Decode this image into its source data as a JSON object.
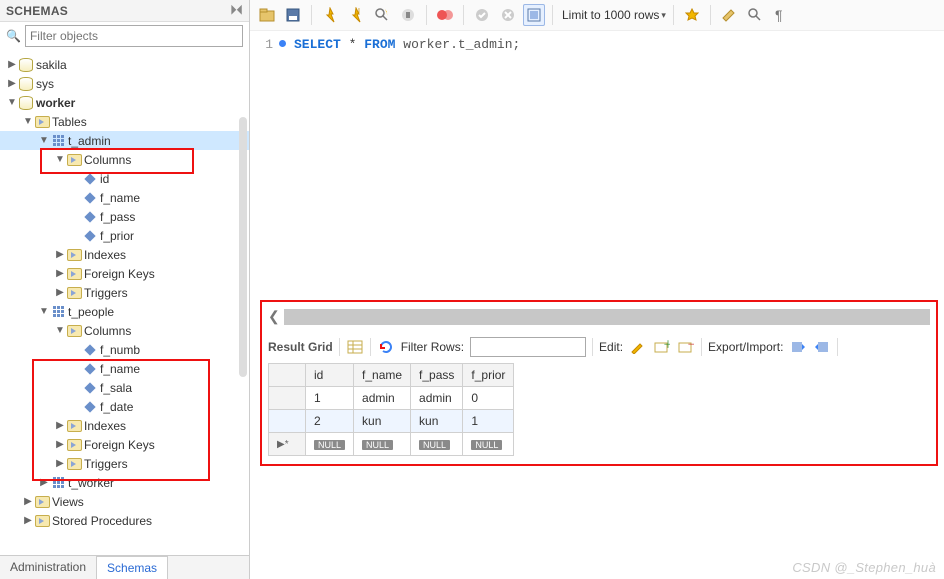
{
  "sidebar": {
    "title": "SCHEMAS",
    "search_placeholder": "Filter objects",
    "tabs": {
      "admin": "Administration",
      "schemas": "Schemas"
    },
    "tree": {
      "sakila": "sakila",
      "sys": "sys",
      "worker": "worker",
      "tables": "Tables",
      "t_admin": "t_admin",
      "t_people": "t_people",
      "t_worker": "t_worker",
      "columns": "Columns",
      "indexes": "Indexes",
      "foreign_keys": "Foreign Keys",
      "triggers": "Triggers",
      "views": "Views",
      "stored_procedures": "Stored Procedures",
      "cols_admin": [
        "id",
        "f_name",
        "f_pass",
        "f_prior"
      ],
      "cols_people": [
        "f_numb",
        "f_name",
        "f_sala",
        "f_date"
      ]
    }
  },
  "toolbar": {
    "limit_label": "Limit to 1000 rows"
  },
  "editor": {
    "line_no": "1",
    "sql_select": "SELECT",
    "sql_star": "*",
    "sql_from": "FROM",
    "sql_target": "worker.t_admin;"
  },
  "results": {
    "grid_label": "Result Grid",
    "filter_label": "Filter Rows:",
    "edit_label": "Edit:",
    "export_label": "Export/Import:",
    "null_label": "NULL",
    "columns": [
      "id",
      "f_name",
      "f_pass",
      "f_prior"
    ],
    "rows": [
      {
        "id": "1",
        "f_name": "admin",
        "f_pass": "admin",
        "f_prior": "0"
      },
      {
        "id": "2",
        "f_name": "kun",
        "f_pass": "kun",
        "f_prior": "1"
      }
    ]
  },
  "watermark": "CSDN @_Stephen_huà"
}
